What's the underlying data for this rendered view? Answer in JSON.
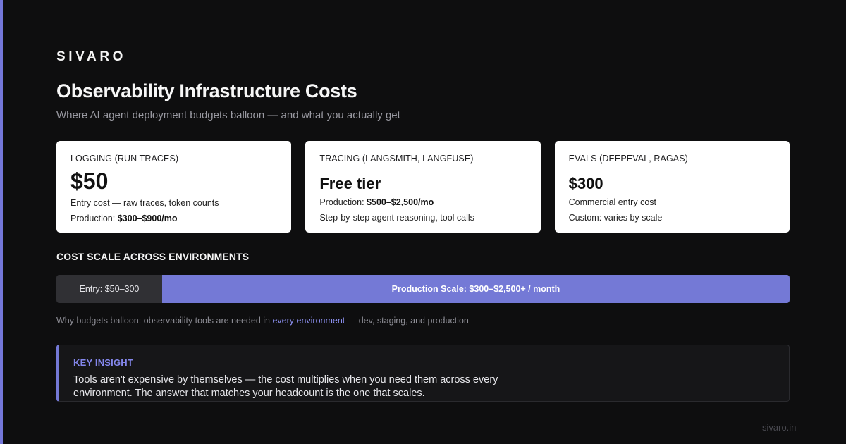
{
  "brand": "SIVARO",
  "title": "Observability Infrastructure Costs",
  "subtitle": "Where AI agent deployment budgets balloon — and what you actually get",
  "cards": [
    {
      "label": "LOGGING (RUN TRACES)",
      "value": "$50",
      "line1": "Entry cost — raw traces, token counts",
      "line2_prefix": "Production: ",
      "line2_bold": "$300–$900/mo"
    },
    {
      "label": "TRACING (LANGSMITH, LANGFUSE)",
      "value": "Free tier",
      "line1_prefix": "Production: ",
      "line1_bold": "$500–$2,500/mo",
      "line2": "Step-by-step agent reasoning, tool calls"
    },
    {
      "label": "EVALS (DEEPEVAL, RAGAS)",
      "value": "$300",
      "line1": "Commercial entry cost",
      "line2": "Custom: varies by scale"
    }
  ],
  "section_heading": "COST SCALE ACROSS ENVIRONMENTS",
  "scale": {
    "entry_label": "Entry: $50–300",
    "production_label": "Production Scale: $300–$2,500+ / month"
  },
  "why": {
    "prefix": "Why budgets balloon: observability tools are needed in ",
    "highlight": "every environment",
    "suffix": " — dev, staging, and production"
  },
  "insight": {
    "label": "KEY INSIGHT",
    "text": "Tools aren't expensive by themselves — the cost multiplies when you need them across every environment. The answer that matches your headcount is the one that scales."
  },
  "footer_url": "sivaro.in",
  "colors": {
    "background": "#0e0e0f",
    "accent": "#7479d6",
    "card": "#ffffff"
  }
}
